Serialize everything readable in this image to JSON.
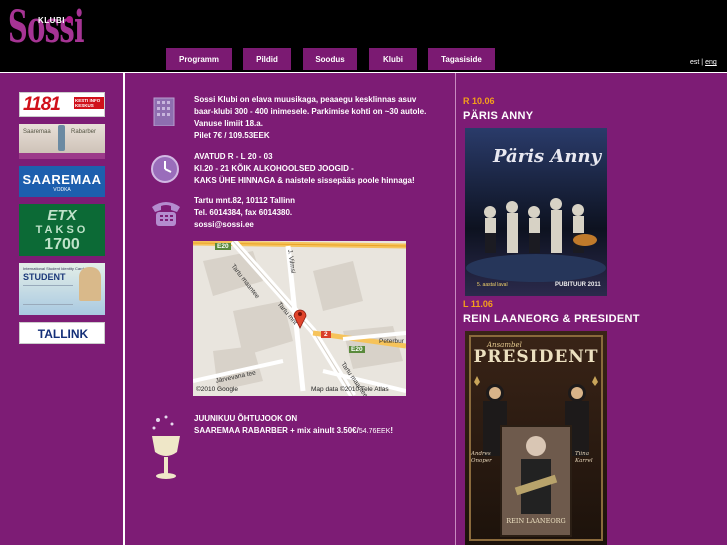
{
  "header": {
    "logo_sub": "KLUBI",
    "logo_text": "Sossi",
    "nav": [
      {
        "label": "Programm"
      },
      {
        "label": "Pildid"
      },
      {
        "label": "Soodus"
      },
      {
        "label": "Klubi"
      },
      {
        "label": "Tagasiside"
      }
    ],
    "lang_est": "est",
    "lang_sep": "|",
    "lang_eng": "eng"
  },
  "sidebar": {
    "ads": [
      {
        "icon": "1181-logo",
        "big": "1181",
        "small": "KESTI INFO KESKUS"
      },
      {
        "icon": "saaremaa-rabarber-ad",
        "t1": "Saaremaa",
        "t2": "Rabarber"
      },
      {
        "icon": "saaremaa-vodka-logo",
        "title": "SAAREMAA",
        "sub": "VODKA"
      },
      {
        "icon": "etx-takso-logo",
        "t1": "ETX",
        "t2": "TAKSO",
        "t3": "1700"
      },
      {
        "icon": "student-card",
        "t0": "International Student Identity Card",
        "t": "STUDENT"
      },
      {
        "icon": "tallink-logo",
        "t": "TALLINK"
      }
    ]
  },
  "info": {
    "about": [
      "Sossi Klubi on elava muusikaga, peaaegu kesklinnas asuv",
      "baar-klubi 300 - 400 inimesele. Parkimise kohti on ~30 autole.",
      "Vanuse limiit 18.a.",
      "Pilet 7€ / 109.53EEK"
    ],
    "hours": [
      "AVATUD R - L 20 - 03",
      "Kl.20 - 21 KÕIK ALKOHOOLSED JOOGID -",
      "KAKS ÜHE HINNAGA & naistele sissepääs poole hinnaga!"
    ],
    "contact": [
      "Tartu mnt.82, 10112 Tallinn",
      "Tel. 6014384, fax 6014380.",
      "sossi@sossi.ee"
    ],
    "promo_line1": "JUUNIKUU ÕHTUJOOK ON",
    "promo_line2": "SAAREMAA RABARBER + mix ainult 3.50€/",
    "promo_small": "54.76EEK",
    "promo_end": "!"
  },
  "map": {
    "labels": {
      "e20_1": "E20",
      "e20_2": "E20",
      "tartu_maantee": "Tartu maantee",
      "tartu_mnt": "Tartu mnt",
      "vilmsi": "J. Vilmsi",
      "peterburi": "Peterbur",
      "jarvevana": "Järvevana tee",
      "tartu_maantee2": "Tartu maantee",
      "marker_num": "2",
      "copyright": "©2010 Google",
      "mapdata": "Map data ©2010 Tele Atlas"
    }
  },
  "events": [
    {
      "date": "R 10.06",
      "title": "PÄRIS ANNY",
      "poster_text": "Päris Anny",
      "poster_foot1": "5. aastal laval",
      "poster_foot2": "PUBITUUR 2011"
    },
    {
      "date": "L 11.06",
      "title": "REIN LAANEORG & PRESIDENT",
      "poster_top": "Ansambel",
      "poster_title": "PRESIDENT",
      "poster_left": "Andres Onoper",
      "poster_right": "Tiina Karrel",
      "poster_foot": "REIN LAANEORG"
    }
  ]
}
